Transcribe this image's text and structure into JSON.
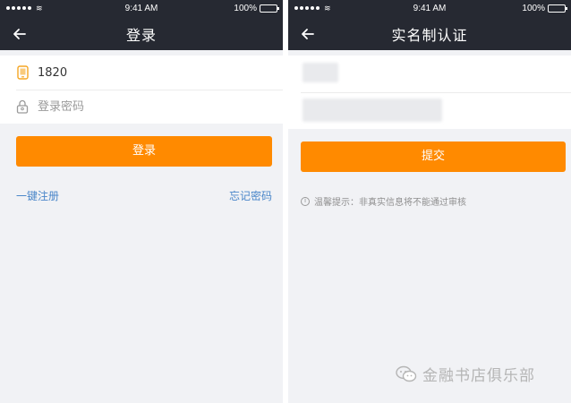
{
  "status_bar": {
    "time": "9:41 AM",
    "battery": "100%",
    "wifi_glyph": "≋"
  },
  "login": {
    "title": "登录",
    "phone_value": "1820",
    "password_placeholder": "登录密码",
    "login_button": "登录",
    "register_link": "一键注册",
    "forgot_link": "忘记密码"
  },
  "realname": {
    "title": "实名制认证",
    "submit_button": "提交",
    "tip_icon": "i",
    "tip": "温馨提示：非真实信息将不能通过审核"
  },
  "watermark": {
    "text": "金融书店俱乐部"
  },
  "colors": {
    "nav_bg": "#262932",
    "accent": "#ff8a00",
    "link": "#4a86c9",
    "page_bg": "#f1f2f5"
  }
}
